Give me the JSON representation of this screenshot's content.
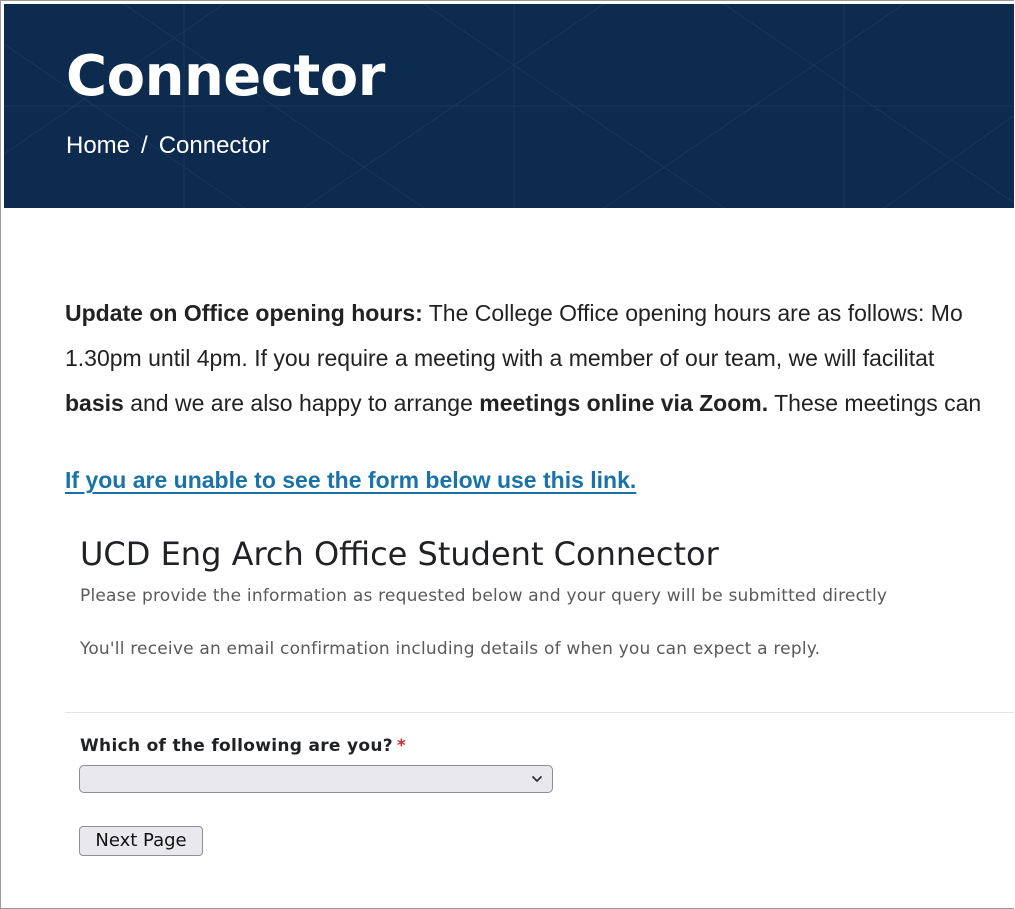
{
  "header": {
    "title": "Connector",
    "breadcrumb": {
      "home": "Home",
      "separator": "/",
      "current": "Connector"
    },
    "background_color": "#0c2b4e"
  },
  "notice": {
    "line1_bold": "Update on Office opening hours:",
    "line1_text": " The College Office opening hours are as follows: Mo",
    "line2_text": "1.30pm until 4pm. If you require a meeting with a member of our team, we will facilitat",
    "line3_bold_a": "basis",
    "line3_text_a": " and we are also happy to arrange ",
    "line3_bold_b": "meetings online via Zoom.",
    "line3_text_b": " These meetings can"
  },
  "form_link": {
    "text": "If you are unable to see the form below use this link.",
    "color": "#1a73a8"
  },
  "form": {
    "title": "UCD Eng Arch Office Student Connector",
    "description_1": "Please provide the information as requested below and your query will be submitted directly",
    "description_2": "You'll receive an email confirmation including details of when you can expect a reply.",
    "question": {
      "label": "Which of the following are you?",
      "required_marker": "*",
      "selected_value": ""
    },
    "next_button": "Next Page",
    "required_color": "#d42b2b"
  },
  "icons": {
    "select_arrow": "chevron-down-icon"
  }
}
